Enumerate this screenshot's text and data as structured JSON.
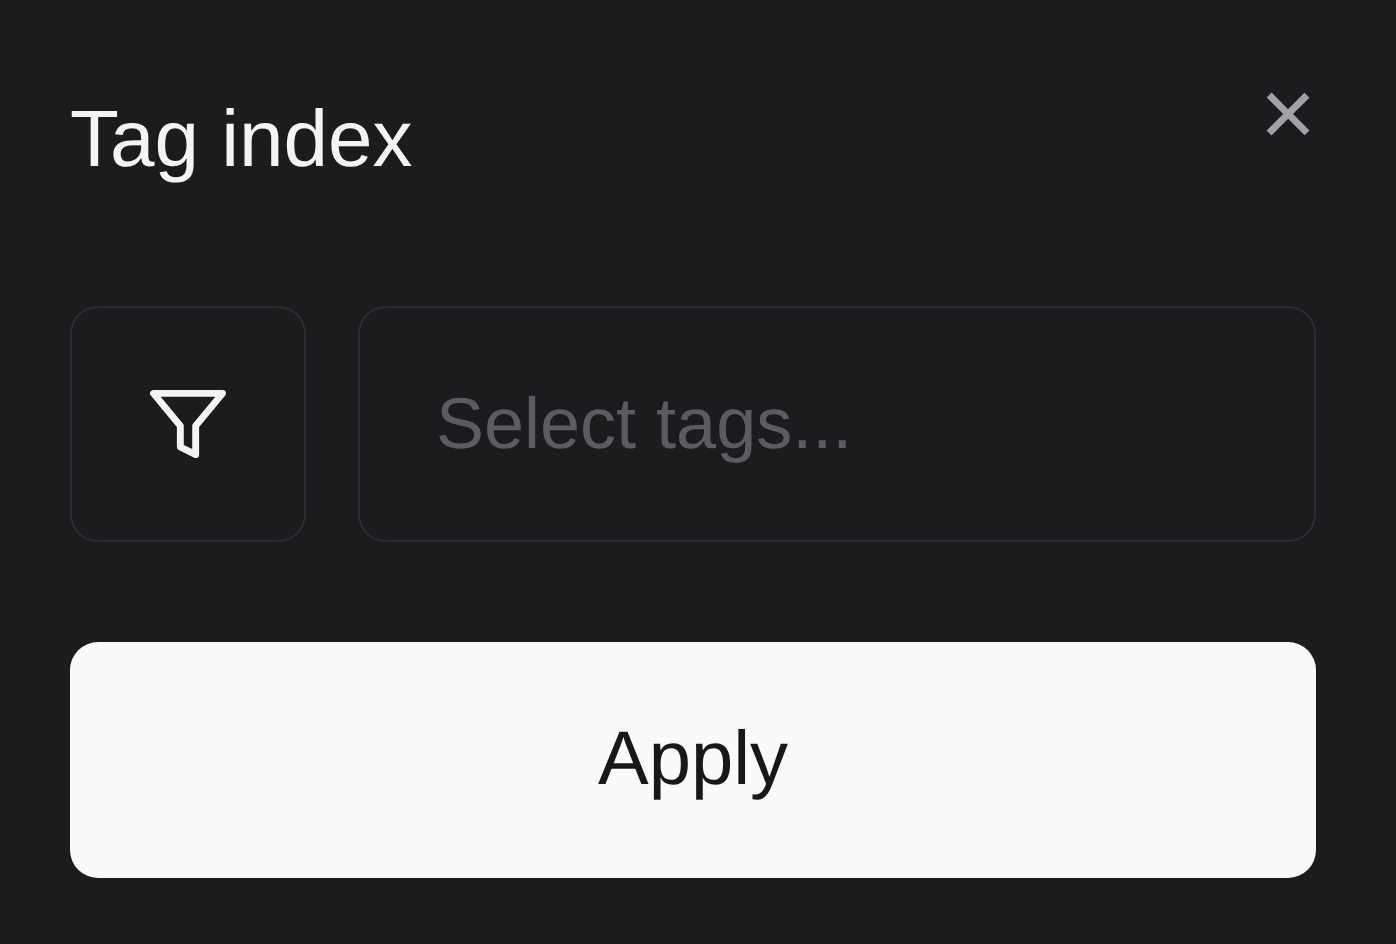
{
  "dialog": {
    "title": "Tag index",
    "close": "×"
  },
  "filter": {
    "placeholder": "Select tags..."
  },
  "buttons": [
    "Apply"
  ]
}
